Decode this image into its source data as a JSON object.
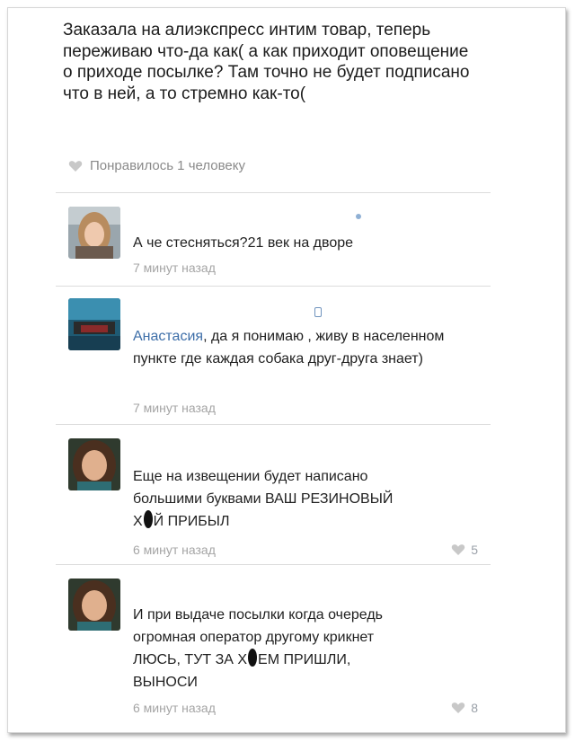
{
  "post": {
    "text": "Заказала на алиэкспресс интим товар, теперь переживаю что-да как( а как приходит оповещение о приходе посылке? Там точно не будет подписано что в ней, а то стремно как-то(",
    "likes": "Понравилось 1 человеку"
  },
  "comments": [
    {
      "text": "А че стесняться?21 век на дворе",
      "time": "7 минут назад"
    },
    {
      "name": "Анастасия",
      "text": ", да я понимаю , живу в населенном пункте где каждая собака друг-друга знает)",
      "time": "7 минут назад"
    },
    {
      "line1": "Еще на извещении будет написано",
      "line2": "большими буквами ВАШ РЕЗИНОВЫЙ",
      "line3a": "Х",
      "line3b": "Й ПРИБЫЛ",
      "time": "6 минут назад",
      "likes": "5"
    },
    {
      "line1": "И при выдаче посылки когда очередь",
      "line2": "огромная оператор другому крикнет",
      "line3a": "ЛЮСЬ, ТУТ ЗА Х",
      "line3b": "ЕМ ПРИШЛИ,",
      "line4": "ВЫНОСИ",
      "time": "6 минут назад",
      "likes": "8"
    }
  ],
  "colors": {
    "name_link": "#3d6ea8",
    "heart": "#c8c8c8",
    "muted": "#a5a5a5"
  }
}
